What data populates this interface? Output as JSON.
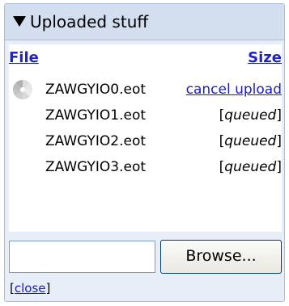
{
  "panel": {
    "title": "Uploaded stuff"
  },
  "table": {
    "headers": {
      "file": "File",
      "size": "Size"
    },
    "rows": [
      {
        "filename": "ZAWGYIO0.eot",
        "status": "cancel upload"
      },
      {
        "filename": "ZAWGYIO1.eot",
        "status": "queued"
      },
      {
        "filename": "ZAWGYIO2.eot",
        "status": "queued"
      },
      {
        "filename": "ZAWGYIO3.eot",
        "status": "queued"
      }
    ]
  },
  "upload": {
    "input_value": "",
    "browse_label": "Browse..."
  },
  "footer": {
    "open_bracket": "[",
    "close_label": "close",
    "close_bracket": "]"
  },
  "icons": {
    "header": "triangle-down-icon",
    "row0": "loading-spinner-icon"
  },
  "colors": {
    "header_bg": "#d3deef",
    "panel_bg": "#e8eef8",
    "link": "#1a1ac8",
    "border": "#aabcdb"
  }
}
